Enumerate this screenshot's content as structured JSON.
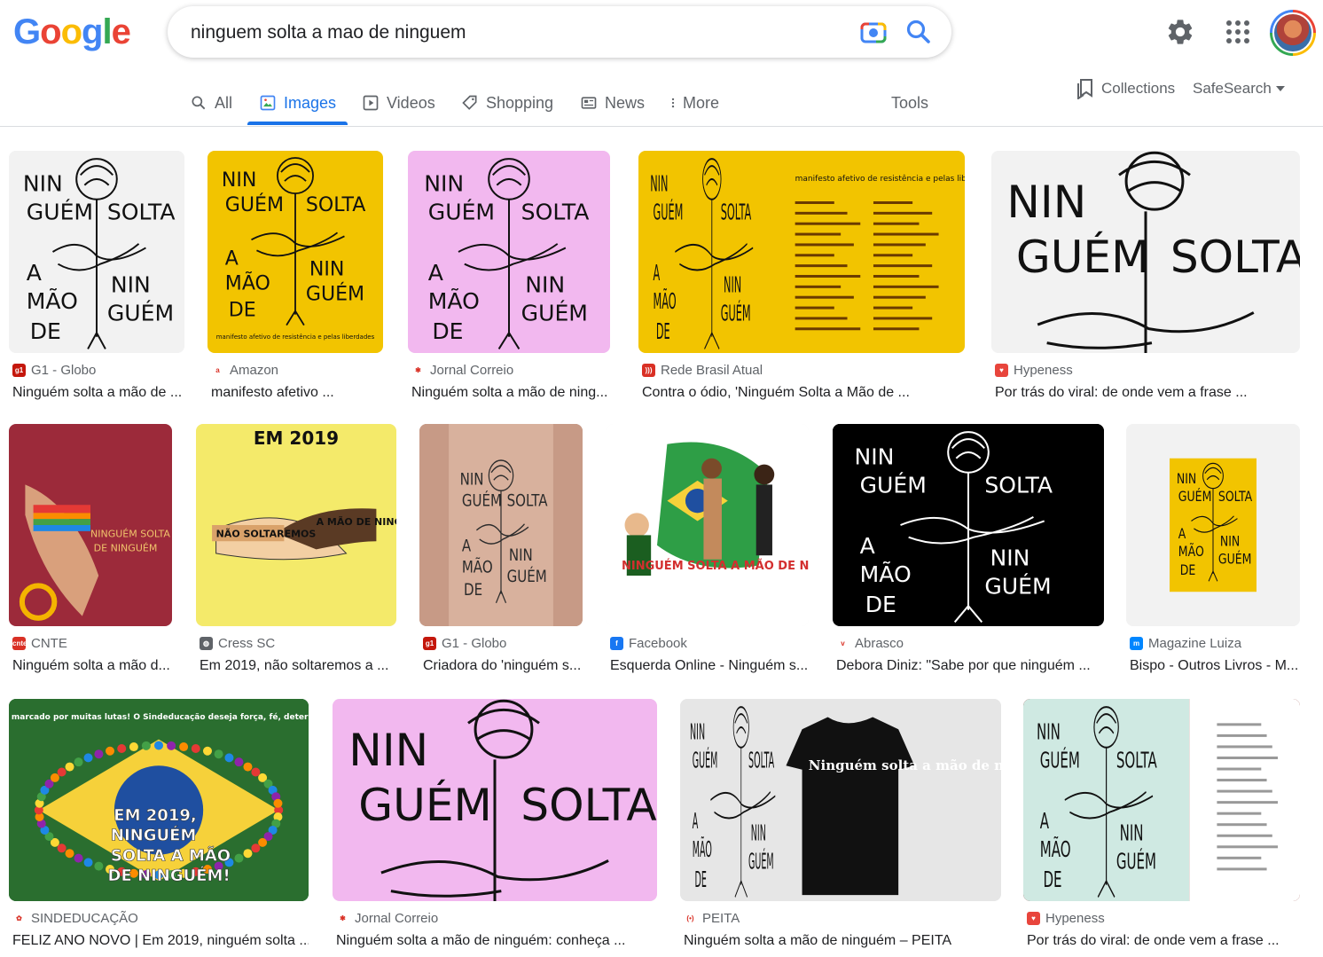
{
  "header": {
    "logo_letters": [
      {
        "ch": "G",
        "color": "#4285f4"
      },
      {
        "ch": "o",
        "color": "#ea4335"
      },
      {
        "ch": "o",
        "color": "#fbbc05"
      },
      {
        "ch": "g",
        "color": "#4285f4"
      },
      {
        "ch": "l",
        "color": "#34a853"
      },
      {
        "ch": "e",
        "color": "#ea4335"
      }
    ],
    "search_query": "ninguem solta a mao de ninguem"
  },
  "tabs": {
    "all": "All",
    "images": "Images",
    "videos": "Videos",
    "shopping": "Shopping",
    "news": "News",
    "more": "More",
    "tools": "Tools",
    "collections": "Collections",
    "safesearch": "SafeSearch"
  },
  "results": [
    {
      "source": "G1 - Globo",
      "title": "Ninguém solta a mão de ...",
      "favicon": "#c4170c",
      "favicon_glyph": "g1",
      "bg": "#f2f2f2",
      "style": "poster-white"
    },
    {
      "source": "Amazon",
      "title": "manifesto afetivo ...",
      "favicon": "#ffffff",
      "favicon_glyph": "a",
      "bg": "#f2c400",
      "style": "book-yellow"
    },
    {
      "source": "Jornal Correio",
      "title": "Ninguém solta a mão de ning...",
      "favicon": "#ffffff",
      "favicon_glyph": "✱",
      "bg": "#f2b8ef",
      "style": "poster-pink"
    },
    {
      "source": "Rede Brasil Atual",
      "title": "Contra o ódio, 'Ninguém Solta a Mão de ...",
      "favicon": "#d93025",
      "favicon_glyph": ")))",
      "bg": "#f2c400",
      "style": "manifesto-yellow"
    },
    {
      "source": "Hypeness",
      "title": "Por trás do viral: de onde vem a frase ...",
      "favicon": "#e8453c",
      "favicon_glyph": "♥",
      "bg": "#f2f2f2",
      "style": "closeup-white"
    },
    {
      "source": "CNTE",
      "title": "Ninguém solta a mão d...",
      "favicon": "#d93025",
      "favicon_glyph": "cnte",
      "bg": "#9c2a3a",
      "style": "hands-red"
    },
    {
      "source": "Cress SC",
      "title": "Em 2019, não soltaremos a ...",
      "favicon": "#5f6368",
      "favicon_glyph": "◍",
      "bg": "#f4ea6a",
      "style": "handshake-yellow"
    },
    {
      "source": "G1 - Globo",
      "title": "Criadora do 'ninguém s...",
      "favicon": "#c4170c",
      "favicon_glyph": "g1",
      "bg": "#c79a86",
      "style": "tattoo"
    },
    {
      "source": "Facebook",
      "title": "Esquerda Online - Ninguém s...",
      "favicon": "#1877f2",
      "favicon_glyph": "f",
      "bg": "#ffffff",
      "style": "cartoon"
    },
    {
      "source": "Abrasco",
      "title": "Debora Diniz: \"Sabe por que ninguém ...",
      "favicon": "#ffffff",
      "favicon_glyph": "v",
      "bg": "#000000",
      "style": "poster-black"
    },
    {
      "source": "Magazine Luiza",
      "title": "Bispo - Outros Livros - M...",
      "favicon": "#0086ff",
      "favicon_glyph": "m",
      "bg": "#f2f2f2",
      "style": "book-small"
    },
    {
      "source": "SINDEDUCAÇÃO",
      "title": "FELIZ ANO NOVO | Em 2019, ninguém solta ...",
      "favicon": "#ffffff",
      "favicon_glyph": "✿",
      "bg": "#2a6e2f",
      "style": "crowd"
    },
    {
      "source": "Jornal Correio",
      "title": "Ninguém solta a mão de ninguém: conheça ...",
      "favicon": "#ffffff",
      "favicon_glyph": "✱",
      "bg": "#f2b8ef",
      "style": "closeup-pink"
    },
    {
      "source": "PEITA",
      "title": "Ninguém solta a mão de ninguém – PEITA",
      "favicon": "#ffffff",
      "favicon_glyph": "(•)",
      "bg": "#e6e6e6",
      "style": "tshirt"
    },
    {
      "source": "Hypeness",
      "title": "Por trás do viral: de onde vem a frase ...",
      "favicon": "#e8453c",
      "favicon_glyph": "♥",
      "bg": "#7a1a14",
      "style": "instagram"
    }
  ],
  "thumb_text": {
    "nin": "NIN",
    "guem": "GUÉM",
    "solta": "SOLTA",
    "a": "A",
    "mao": "MÃO",
    "de": "DE",
    "manifesto_heading": "manifesto afetivo de resistência e pelas liberdades",
    "em_2019": "EM 2019",
    "nao_soltaremos": "NÃO SOLTAREMOS",
    "a_mao_de_ninguem": "A MÃO DE NINGUÉM",
    "ninguem_solta_a_mao": "NINGUÉM SOLTA A MÃO",
    "de_ninguem": "DE NINGUÉM",
    "cartoon_caption": "NINGUÉM SOLTA A MÃO DE NINGUÉM!",
    "crowd_header": "O próximo ano será marcado por muitas lutas! O Sindeducação deseja força, fé, determinação e unidade!",
    "crowd_line1": "EM 2019,",
    "crowd_line2": "NINGUÉM",
    "crowd_line3": "SOLTA A MÃO",
    "crowd_line4": "DE NINGUÉM!",
    "tshirt_text": "Ninguém solta a mão de ninguém."
  }
}
